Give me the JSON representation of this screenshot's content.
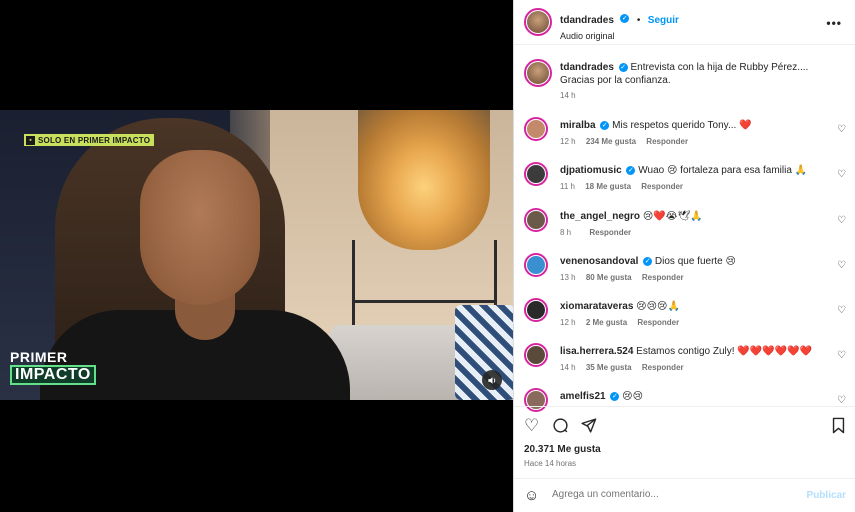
{
  "video": {
    "badge_text": "SOLO EN PRIMER IMPACTO",
    "logo_top": "PRIMER",
    "logo_bottom": "IMPACTO"
  },
  "header": {
    "username": "tdandrades",
    "follow_label": "Seguir",
    "audio_label": "Audio original",
    "separator": "•"
  },
  "caption": {
    "username": "tdandrades",
    "text": "Entrevista con la hija de Rubby Pérez.... Gracias por la confianza.",
    "time": "14 h"
  },
  "comments": [
    {
      "username": "miralba",
      "verified": true,
      "text": "Mis respetos querido Tony... ❤️",
      "time": "12 h",
      "likes": "234 Me gusta",
      "reply": "Responder",
      "avatar_color": "#c28a6b"
    },
    {
      "username": "djpatiomusic",
      "verified": true,
      "text": "Wuao 😢 fortaleza para esa familia 🙏",
      "time": "11 h",
      "likes": "18 Me gusta",
      "reply": "Responder",
      "avatar_color": "#3b3b3b"
    },
    {
      "username": "the_angel_negro",
      "verified": false,
      "text": "😢❤️😭🕊🙏",
      "time": "8 h",
      "likes": "",
      "reply": "Responder",
      "avatar_color": "#6b5a4a"
    },
    {
      "username": "venenosandoval",
      "verified": true,
      "text": "Dios que fuerte 😢",
      "time": "13 h",
      "likes": "80 Me gusta",
      "reply": "Responder",
      "avatar_color": "#3a8fd0"
    },
    {
      "username": "xiomarataveras",
      "verified": false,
      "text": "😢😢😢🙏",
      "time": "12 h",
      "likes": "2 Me gusta",
      "reply": "Responder",
      "avatar_color": "#2a2a2a"
    },
    {
      "username": "lisa.herrera.524",
      "verified": false,
      "text": "Estamos contigo Zuly! ❤️❤️❤️❤️❤️❤️",
      "time": "14 h",
      "likes": "35 Me gusta",
      "reply": "Responder",
      "avatar_color": "#5a4a3a"
    },
    {
      "username": "amelfis21",
      "verified": true,
      "text": "😢😢",
      "time": "",
      "likes": "",
      "reply": "",
      "avatar_color": "#8a6a5a"
    }
  ],
  "post": {
    "likes": "20.371 Me gusta",
    "time": "Hace 14 horas"
  },
  "composer": {
    "placeholder": "Agrega un comentario...",
    "publish": "Publicar"
  },
  "icons": {
    "heart": "heart-icon",
    "comment": "comment-icon",
    "share": "share-icon",
    "save": "bookmark-icon",
    "emoji": "emoji-icon",
    "audio": "speaker-icon"
  }
}
